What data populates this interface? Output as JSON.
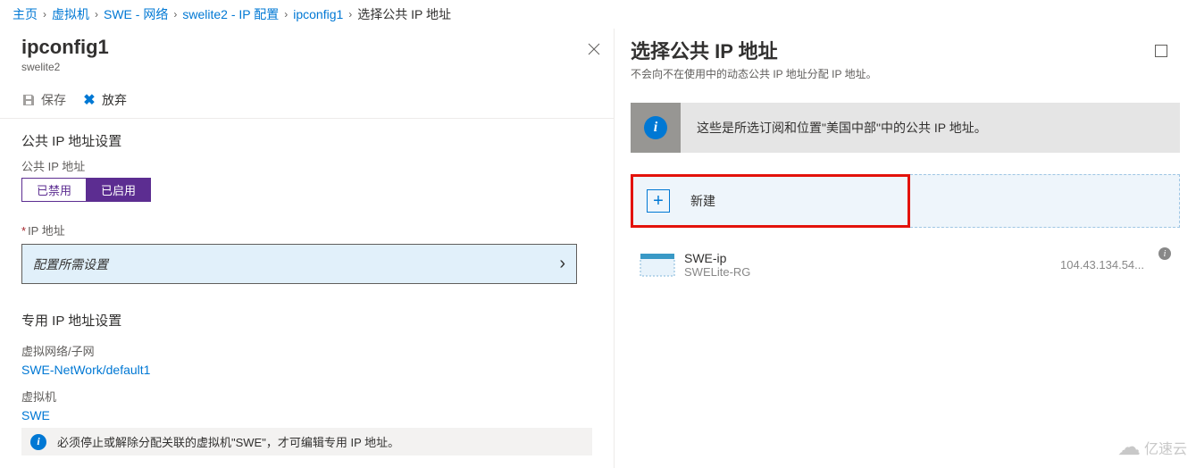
{
  "breadcrumb": {
    "items": [
      "主页",
      "虚拟机",
      "SWE - 网络",
      "swelite2 - IP 配置",
      "ipconfig1"
    ],
    "current": "选择公共 IP 地址"
  },
  "left": {
    "title": "ipconfig1",
    "subtitle": "swelite2",
    "toolbar": {
      "save": "保存",
      "discard": "放弃"
    },
    "public_ip_section": "公共 IP 地址设置",
    "public_ip_label": "公共 IP 地址",
    "toggle": {
      "disabled": "已禁用",
      "enabled": "已启用"
    },
    "ip_address_label": "IP 地址",
    "ip_placeholder": "配置所需设置",
    "private_ip_section": "专用 IP 地址设置",
    "vnet_label": "虚拟网络/子网",
    "vnet_value": "SWE-NetWork/default1",
    "vm_label": "虚拟机",
    "vm_value": "SWE",
    "footer_info": "必须停止或解除分配关联的虚拟机\"SWE\"，才可编辑专用 IP 地址。"
  },
  "right": {
    "title": "选择公共 IP 地址",
    "subtitle": "不会向不在使用中的动态公共 IP 地址分配 IP 地址。",
    "info_msg": "这些是所选订阅和位置\"美国中部\"中的公共 IP 地址。",
    "create_new": "新建",
    "ip_item": {
      "name": "SWE-ip",
      "rg": "SWELite-RG",
      "addr": "104.43.134.54..."
    }
  },
  "watermark": "亿速云"
}
